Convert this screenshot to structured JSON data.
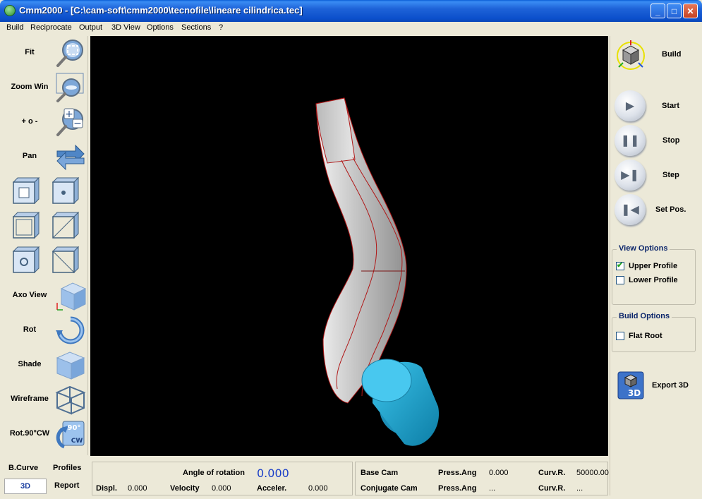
{
  "window": {
    "title": "Cmm2000 - [C:\\cam-soft\\cmm2000\\tecnofile\\lineare cilindrica.tec]",
    "minimize": "_",
    "maximize": "□",
    "close": "✕"
  },
  "menu": [
    "Build",
    "Reciprocate",
    "Output",
    "3D View",
    "Options",
    "Sections",
    "?"
  ],
  "left_toolbar": {
    "fit": "Fit",
    "zoom_win": "Zoom Win",
    "zoom_pm": "+ o -",
    "pan": "Pan",
    "axo_view": "Axo View",
    "rot": "Rot",
    "shade": "Shade",
    "wireframe": "Wireframe",
    "rot90": "Rot.90°CW",
    "rot90_icon_top": "90°",
    "rot90_icon_bottom": "CW"
  },
  "right_panel": {
    "build": "Build",
    "start": "Start",
    "stop": "Stop",
    "step": "Step",
    "set_pos": "Set Pos.",
    "view_options": {
      "title": "View Options",
      "upper_profile": "Upper Profile",
      "upper_checked": true,
      "lower_profile": "Lower Profile",
      "lower_checked": false
    },
    "build_options": {
      "title": "Build Options",
      "flat_root": "Flat Root",
      "flat_root_checked": false
    },
    "export_3d": "Export 3D",
    "export_icon_text": "3D"
  },
  "bottom_left": {
    "b_curve": "B.Curve",
    "profiles": "Profiles",
    "tab_3d": "3D",
    "report": "Report"
  },
  "motion": {
    "angle_label": "Angle of rotation",
    "angle_value": "0.000",
    "displ_label": "Displ.",
    "displ_value": "0.000",
    "velocity_label": "Velocity",
    "velocity_value": "0.000",
    "accel_label": "Acceler.",
    "accel_value": "0.000"
  },
  "cam_info": {
    "base_cam": "Base Cam",
    "conjugate_cam": "Conjugate Cam",
    "press_ang_label": "Press.Ang",
    "base_press_ang": "0.000",
    "conj_press_ang": "...",
    "curv_r_label": "Curv.R.",
    "base_curv_r": "50000.00",
    "conj_curv_r": "..."
  },
  "colors": {
    "viewport_bg": "#000000",
    "cam_body": "#c8c8c8",
    "cam_edge": "#b01818",
    "follower": "#1aa8d0",
    "value_blue": "#1a3ec8"
  }
}
